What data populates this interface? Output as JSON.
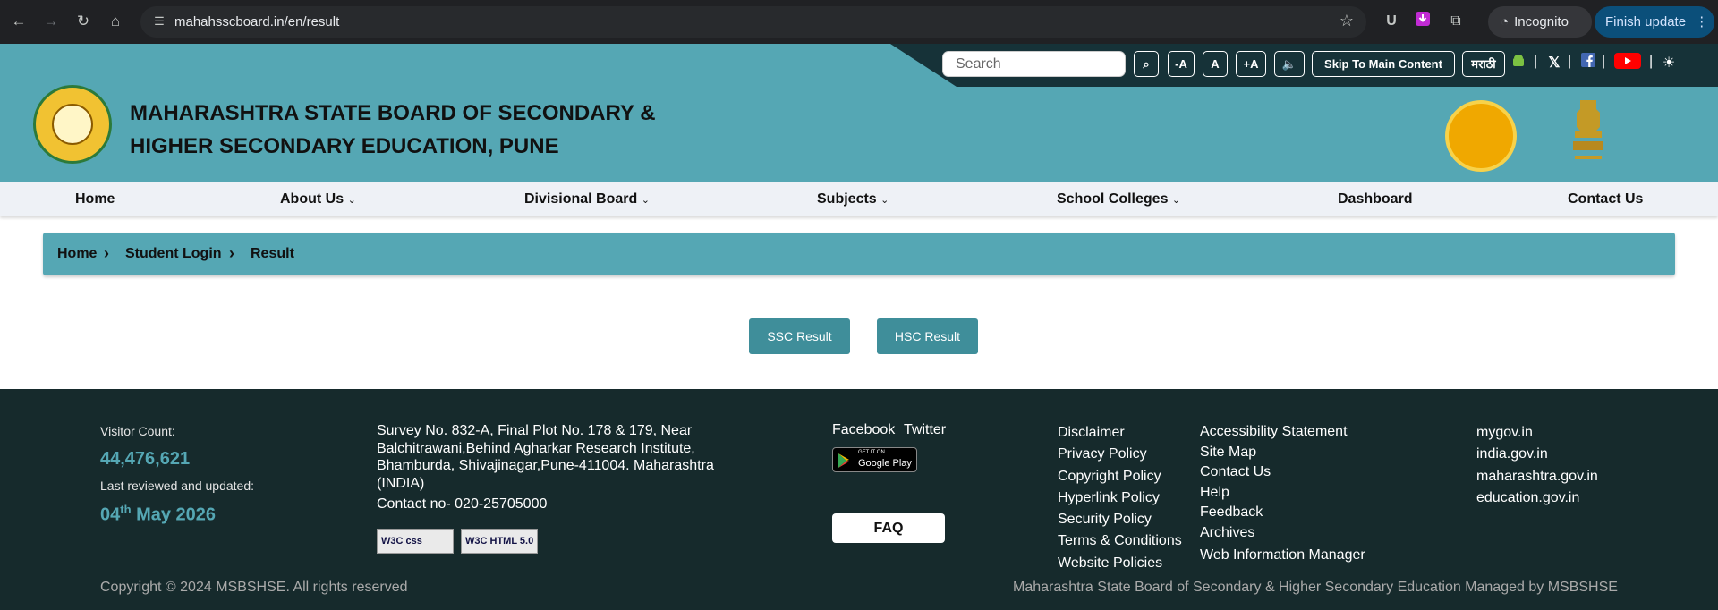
{
  "browser": {
    "url": "mahahsscboard.in/en/result",
    "incognito_label": "Incognito",
    "update_label": "Finish update"
  },
  "toolbar": {
    "search_placeholder": "Search",
    "font_decrease": "-A",
    "font_normal": "A",
    "font_increase": "+A",
    "skip_label": "Skip To Main Content",
    "language_label": "मराठी"
  },
  "header": {
    "title_line1": "MAHARASHTRA STATE BOARD OF SECONDARY &",
    "title_line2": "HIGHER SECONDARY EDUCATION, PUNE"
  },
  "nav": {
    "items": [
      {
        "label": "Home"
      },
      {
        "label": "About Us"
      },
      {
        "label": "Divisional Board"
      },
      {
        "label": "Subjects"
      },
      {
        "label": "School Colleges"
      },
      {
        "label": "Dashboard"
      },
      {
        "label": "Contact Us"
      }
    ]
  },
  "breadcrumb": {
    "items": [
      "Home",
      "Student Login",
      "Result"
    ]
  },
  "results": {
    "ssc_label": "SSC Result",
    "hsc_label": "HSC Result"
  },
  "footer": {
    "visitor_label": "Visitor Count:",
    "visitor_count": "44,476,621",
    "reviewed_label": "Last reviewed and updated:",
    "reviewed_day": "04",
    "reviewed_suffix": "th",
    "reviewed_rest": " May 2026",
    "address": [
      "Survey No. 832-A, Final Plot No. 178 & 179, Near",
      "Balchitrawani,Behind Agharkar Research Institute,",
      "Bhamburda, Shivajinagar,Pune-411004. Maharashtra",
      "(INDIA)"
    ],
    "contact": "Contact no- 020-25705000",
    "badge_css": "W3C css",
    "badge_html": "W3C HTML 5.0",
    "social_facebook": "Facebook",
    "social_twitter": "Twitter",
    "gplay_small": "GET IT ON",
    "gplay_big": "Google Play",
    "faq_label": "FAQ",
    "links_col1": [
      "Disclaimer",
      "Privacy Policy",
      "Copyright Policy",
      "Hyperlink Policy",
      "Security Policy",
      "Terms & Conditions",
      "Website Policies"
    ],
    "links_col2": [
      "Accessibility Statement",
      "Site Map",
      "Contact Us",
      "Help",
      "Feedback",
      "Archives",
      "Web Information Manager"
    ],
    "links_col3": [
      "mygov.in",
      "india.gov.in",
      "maharashtra.gov.in",
      "education.gov.in"
    ],
    "copyright": "Copyright © 2024 MSBSHSE. All rights reserved",
    "managed_by": "Maharashtra State Board of Secondary & Higher Secondary Education Managed by MSBSHSE"
  },
  "colors": {
    "header_teal": "#55a7b4",
    "button_teal": "#3f8e9a",
    "footer_bg": "#162a2c"
  }
}
